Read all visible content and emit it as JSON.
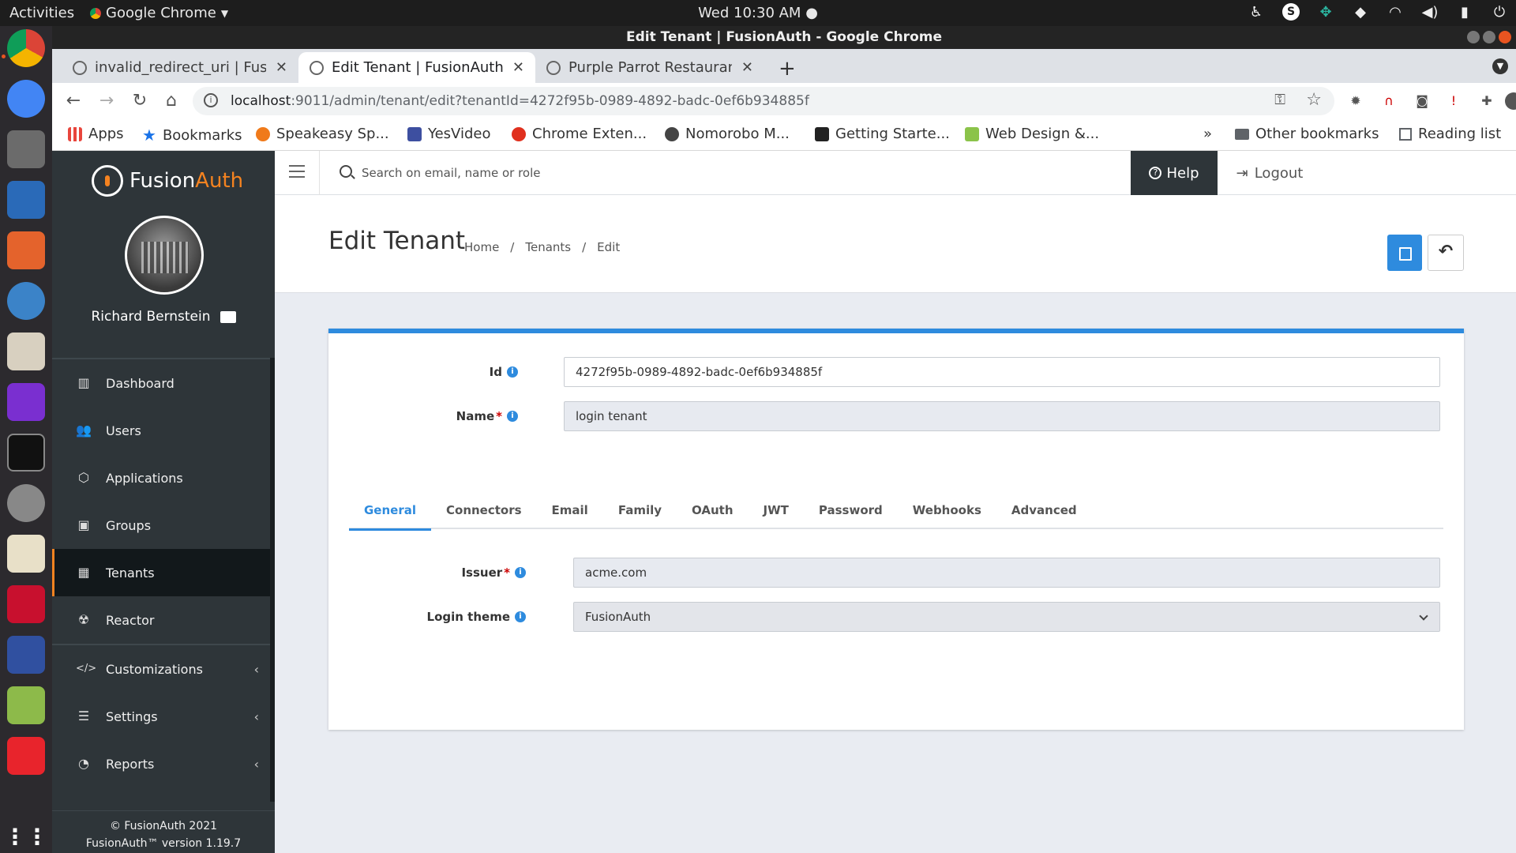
{
  "os": {
    "activities": "Activities",
    "app_menu": "Google Chrome",
    "clock": "Wed 10:30 AM"
  },
  "window": {
    "title": "Edit Tenant | FusionAuth - Google Chrome"
  },
  "tabs": [
    {
      "label": "invalid_redirect_uri | Fusio"
    },
    {
      "label": "Edit Tenant | FusionAuth"
    },
    {
      "label": "Purple Parrot Restaurant"
    }
  ],
  "address": {
    "host": "localhost",
    "path": ":9011/admin/tenant/edit?tenantId=4272f95b-0989-4892-badc-0ef6b934885f"
  },
  "bookmarks": [
    {
      "label": "Apps",
      "color": "#e8453c"
    },
    {
      "label": "Bookmarks",
      "color": "#1a73e8"
    },
    {
      "label": "Speakeasy Sp...",
      "color": "#f07a1a"
    },
    {
      "label": "YesVideo",
      "color": "#3d4fa0"
    },
    {
      "label": "Chrome Exten...",
      "color": "#e0301e"
    },
    {
      "label": "Nomorobo M...",
      "color": "#444444"
    },
    {
      "label": "Getting Starte...",
      "color": "#222222"
    },
    {
      "label": "Web Design &...",
      "color": "#8bc34a"
    }
  ],
  "bookmarks_more": "»",
  "other_bookmarks": "Other bookmarks",
  "reading_list": "Reading list",
  "sidebar": {
    "brand_a": "Fusion",
    "brand_b": "Auth",
    "user_name": "Richard Bernstein",
    "menu": [
      {
        "label": "Dashboard",
        "icon": "▥"
      },
      {
        "label": "Users",
        "icon": "👥"
      },
      {
        "label": "Applications",
        "icon": "⬡"
      },
      {
        "label": "Groups",
        "icon": "▣"
      },
      {
        "label": "Tenants",
        "icon": "▦"
      },
      {
        "label": "Reactor",
        "icon": "☢"
      },
      {
        "label": "Customizations",
        "icon": "</>"
      },
      {
        "label": "Settings",
        "icon": "☰"
      },
      {
        "label": "Reports",
        "icon": "◔"
      }
    ],
    "footer_line1": "© FusionAuth 2021",
    "footer_line2": "FusionAuth™ version 1.19.7"
  },
  "header": {
    "search_placeholder": "Search on email, name or role",
    "help": "Help",
    "logout": "Logout"
  },
  "page": {
    "title": "Edit Tenant",
    "crumb_home": "Home",
    "crumb_tenants": "Tenants",
    "crumb_edit": "Edit",
    "crumb_sep": "/"
  },
  "form": {
    "id_label": "Id",
    "id_value": "4272f95b-0989-4892-badc-0ef6b934885f",
    "name_label": "Name",
    "name_value": "login tenant",
    "tabs": [
      "General",
      "Connectors",
      "Email",
      "Family",
      "OAuth",
      "JWT",
      "Password",
      "Webhooks",
      "Advanced"
    ],
    "issuer_label": "Issuer",
    "issuer_value": "acme.com",
    "theme_label": "Login theme",
    "theme_value": "FusionAuth",
    "required_mark": "*"
  },
  "colors": {
    "accent": "#2e8bde",
    "brand_orange": "#f58320",
    "sidebar_bg": "#2e3539"
  }
}
